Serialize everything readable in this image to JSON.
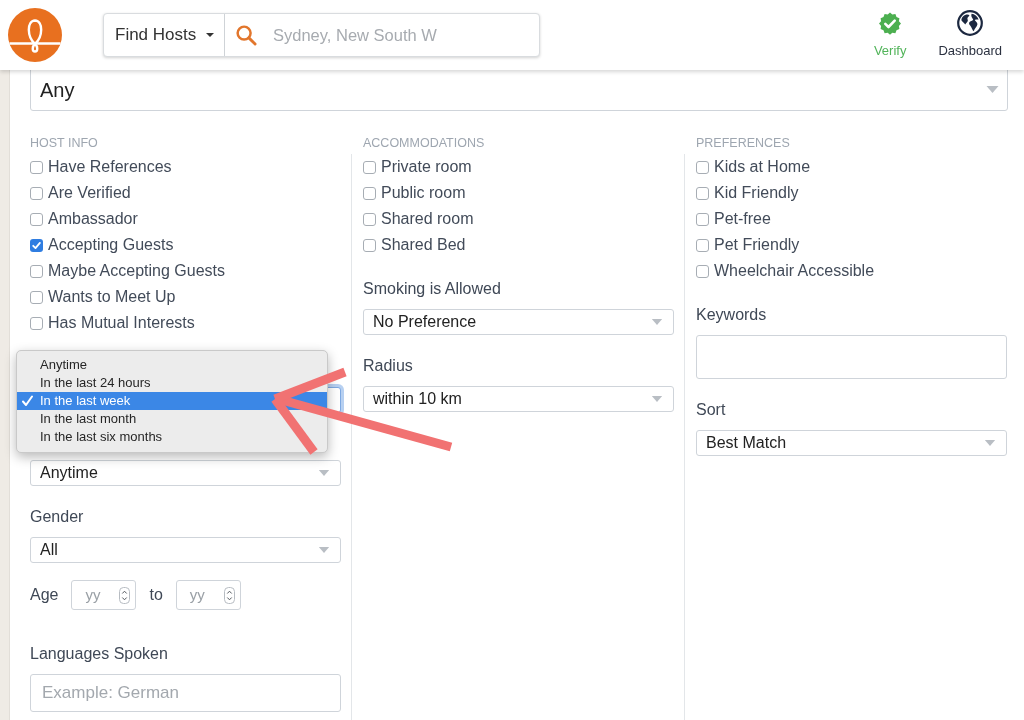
{
  "header": {
    "search_type": {
      "label": "Find Hosts"
    },
    "search": {
      "placeholder": "Sydney, New South W"
    },
    "nav": [
      {
        "kind": "verify",
        "label": "Verify"
      },
      {
        "kind": "dashboard",
        "label": "Dashboard"
      }
    ]
  },
  "location_select": {
    "value": "Any"
  },
  "columns": [
    {
      "heading": "HOST INFO",
      "options": [
        {
          "label": "Have References",
          "checked": false
        },
        {
          "label": "Are Verified",
          "checked": false
        },
        {
          "label": "Ambassador",
          "checked": false
        },
        {
          "label": "Accepting Guests",
          "checked": true
        },
        {
          "label": "Maybe Accepting Guests",
          "checked": false
        },
        {
          "label": "Wants to Meet Up",
          "checked": false
        },
        {
          "label": "Has Mutual Interests",
          "checked": false
        }
      ],
      "fields": [
        {
          "kind": "select",
          "focused": true,
          "menu": [
            {
              "label": "Anytime",
              "selected": false
            },
            {
              "label": "In the last 24 hours",
              "selected": false
            },
            {
              "label": "In the last week",
              "selected": true
            },
            {
              "label": "In the last month",
              "selected": false
            },
            {
              "label": "In the last six months",
              "selected": false
            }
          ]
        },
        {
          "kind": "select",
          "focused": false,
          "value": "Anytime"
        },
        {
          "kind": "select",
          "focused": false,
          "label": "Gender",
          "value": "All"
        },
        {
          "kind": "range",
          "label": "Age",
          "from_placeholder": "yy",
          "separator": "to",
          "to_placeholder": "yy"
        },
        {
          "kind": "text",
          "label": "Languages Spoken",
          "placeholder": "Example: German"
        }
      ]
    },
    {
      "heading": "ACCOMMODATIONS",
      "options": [
        {
          "label": "Private room",
          "checked": false
        },
        {
          "label": "Public room",
          "checked": false
        },
        {
          "label": "Shared room",
          "checked": false
        },
        {
          "label": "Shared Bed",
          "checked": false
        }
      ],
      "fields": [
        {
          "kind": "select",
          "focused": false,
          "label": "Smoking is Allowed",
          "value": "No Preference"
        },
        {
          "kind": "select",
          "focused": false,
          "label": "Radius",
          "value": "within 10 km"
        }
      ]
    },
    {
      "heading": "PREFERENCES",
      "options": [
        {
          "label": "Kids at Home",
          "checked": false
        },
        {
          "label": "Kid Friendly",
          "checked": false
        },
        {
          "label": "Pet-free",
          "checked": false
        },
        {
          "label": "Pet Friendly",
          "checked": false
        },
        {
          "label": "Wheelchair Accessible",
          "checked": false
        }
      ],
      "fields": [
        {
          "kind": "textarea",
          "label": "Keywords"
        },
        {
          "kind": "select",
          "focused": false,
          "label": "Sort",
          "value": "Best Match"
        }
      ]
    }
  ]
}
